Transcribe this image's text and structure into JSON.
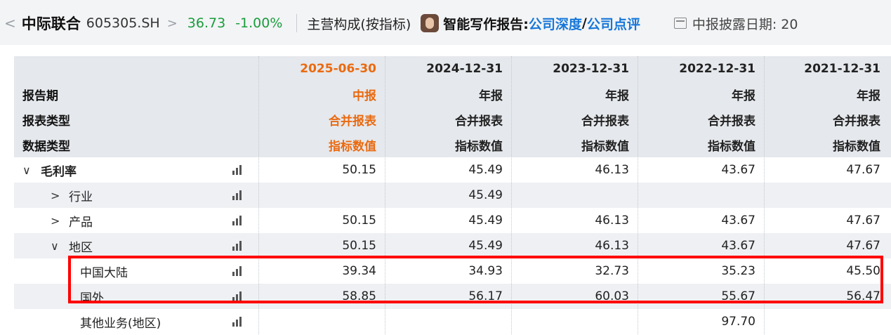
{
  "header": {
    "back": "<",
    "stock_name": "中际联合",
    "stock_code": "605305.SH",
    "chevron": ">",
    "price": "36.73",
    "change": "-1.00%",
    "segment_label": "主营构成(按指标)",
    "report_label": "智能写作报告:",
    "link_deep": "公司深度",
    "slash": "/",
    "link_review": "公司点评",
    "disclosure_label": "中报披露日期: 20",
    "icons": [
      "avatar",
      "calendar-icon"
    ],
    "colors": {
      "up_down": "#1a9c3c",
      "link": "#1677d9",
      "current_period": "#ea6a10",
      "highlight": "#ff0000"
    }
  },
  "table": {
    "row_labels": [
      "报告期",
      "报表类型",
      "数据类型"
    ],
    "columns": [
      {
        "date": "2025-06-30",
        "period": "中报",
        "type": "合并报表",
        "data": "指标数值"
      },
      {
        "date": "2024-12-31",
        "period": "年报",
        "type": "合并报表",
        "data": "指标数值"
      },
      {
        "date": "2023-12-31",
        "period": "年报",
        "type": "合并报表",
        "data": "指标数值"
      },
      {
        "date": "2022-12-31",
        "period": "年报",
        "type": "合并报表",
        "data": "指标数值"
      },
      {
        "date": "2021-12-31",
        "period": "年报",
        "type": "合并报表",
        "data": "指标数值"
      }
    ],
    "rows": [
      {
        "caret": "∨",
        "label": "毛利率",
        "values": [
          "50.15",
          "45.49",
          "46.13",
          "43.67",
          "47.67"
        ]
      },
      {
        "caret": ">",
        "label": "行业",
        "values": [
          "",
          "45.49",
          "",
          "",
          ""
        ]
      },
      {
        "caret": ">",
        "label": "产品",
        "values": [
          "50.15",
          "45.49",
          "46.13",
          "43.67",
          "47.67"
        ]
      },
      {
        "caret": "∨",
        "label": "地区",
        "values": [
          "50.15",
          "45.49",
          "46.13",
          "43.67",
          "47.67"
        ]
      },
      {
        "caret": "",
        "label": "中国大陆",
        "values": [
          "39.34",
          "34.93",
          "32.73",
          "35.23",
          "45.50"
        ]
      },
      {
        "caret": "",
        "label": "国外",
        "values": [
          "58.85",
          "56.17",
          "60.03",
          "55.67",
          "56.47"
        ]
      },
      {
        "caret": "",
        "label": "其他业务(地区)",
        "values": [
          "",
          "",
          "",
          "97.70",
          ""
        ]
      }
    ]
  }
}
